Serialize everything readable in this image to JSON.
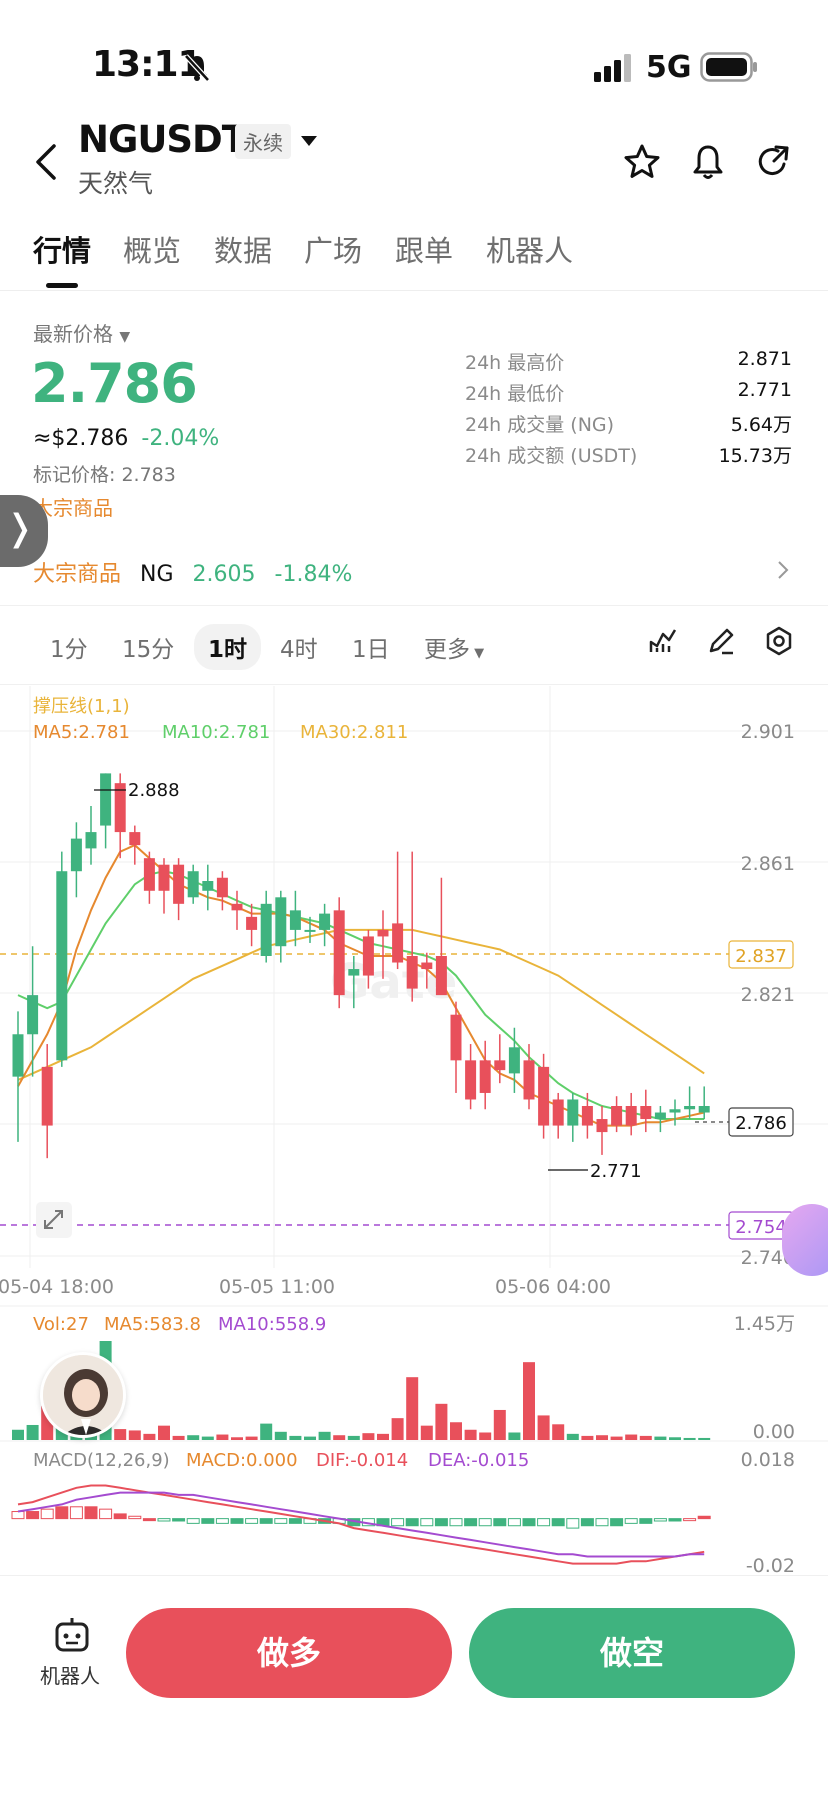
{
  "status_bar": {
    "time": "13:11",
    "network": "5G"
  },
  "header": {
    "pair": "NGUSDT",
    "pair_type": "永续",
    "subtitle": "天然气"
  },
  "tabs": [
    {
      "label": "行情",
      "active": true
    },
    {
      "label": "概览",
      "active": false
    },
    {
      "label": "数据",
      "active": false
    },
    {
      "label": "广场",
      "active": false
    },
    {
      "label": "跟单",
      "active": false
    },
    {
      "label": "机器人",
      "active": false
    }
  ],
  "price": {
    "latest_label": "最新价格",
    "latest": "2.786",
    "usd_value": "≈$2.786",
    "change": "-2.04%",
    "mark_price": "标记价格: 2.783",
    "commodity_tag": "大宗商品"
  },
  "stats": [
    {
      "label": "24h 最高价",
      "value": "2.871"
    },
    {
      "label": "24h 最低价",
      "value": "2.771"
    },
    {
      "label": "24h 成交量 (NG)",
      "value": "5.64万"
    },
    {
      "label": "24h 成交额 (USDT)",
      "value": "15.73万"
    }
  ],
  "commodity_row": {
    "category": "大宗商品",
    "symbol": "NG",
    "price": "2.605",
    "change": "-1.84%"
  },
  "intervals": [
    {
      "label": "1分",
      "active": false
    },
    {
      "label": "15分",
      "active": false
    },
    {
      "label": "1时",
      "active": true
    },
    {
      "label": "4时",
      "active": false
    },
    {
      "label": "1日",
      "active": false
    },
    {
      "label": "更多",
      "active": false
    }
  ],
  "colors": {
    "up": "#3fb37f",
    "down": "#e8505b",
    "accent": "#e6892f",
    "ma5": "#e6892f",
    "ma10": "#5fcf6a",
    "ma30": "#e9b43a"
  },
  "chart_data": {
    "type": "candlestick",
    "indicator": "撑压线(1,1)",
    "ma_legend": {
      "ma5": "MA5:2.781",
      "ma10": "MA10:2.781",
      "ma30": "MA30:2.811"
    },
    "y_ticks": [
      "2.901",
      "2.861",
      "2.821",
      "2.740"
    ],
    "ylim": [
      2.74,
      2.901
    ],
    "x_ticks": [
      "05-04 18:00",
      "05-05 11:00",
      "05-06 04:00"
    ],
    "high_marker": "2.888",
    "low_marker": "2.771",
    "levels": {
      "resistance": "2.837",
      "current": "2.786",
      "support": "2.754"
    },
    "candles": [
      {
        "o": 2.795,
        "h": 2.815,
        "l": 2.775,
        "c": 2.808
      },
      {
        "o": 2.808,
        "h": 2.835,
        "l": 2.795,
        "c": 2.82
      },
      {
        "o": 2.798,
        "h": 2.805,
        "l": 2.77,
        "c": 2.78
      },
      {
        "o": 2.8,
        "h": 2.864,
        "l": 2.798,
        "c": 2.858
      },
      {
        "o": 2.858,
        "h": 2.873,
        "l": 2.85,
        "c": 2.868
      },
      {
        "o": 2.865,
        "h": 2.878,
        "l": 2.86,
        "c": 2.87
      },
      {
        "o": 2.872,
        "h": 2.888,
        "l": 2.865,
        "c": 2.888
      },
      {
        "o": 2.885,
        "h": 2.888,
        "l": 2.862,
        "c": 2.87
      },
      {
        "o": 2.87,
        "h": 2.872,
        "l": 2.86,
        "c": 2.866
      },
      {
        "o": 2.862,
        "h": 2.864,
        "l": 2.848,
        "c": 2.852
      },
      {
        "o": 2.86,
        "h": 2.862,
        "l": 2.845,
        "c": 2.852
      },
      {
        "o": 2.86,
        "h": 2.862,
        "l": 2.843,
        "c": 2.848
      },
      {
        "o": 2.85,
        "h": 2.86,
        "l": 2.848,
        "c": 2.858
      },
      {
        "o": 2.852,
        "h": 2.86,
        "l": 2.846,
        "c": 2.855
      },
      {
        "o": 2.856,
        "h": 2.858,
        "l": 2.846,
        "c": 2.85
      },
      {
        "o": 2.848,
        "h": 2.852,
        "l": 2.84,
        "c": 2.846
      },
      {
        "o": 2.844,
        "h": 2.848,
        "l": 2.835,
        "c": 2.84
      },
      {
        "o": 2.832,
        "h": 2.852,
        "l": 2.83,
        "c": 2.848
      },
      {
        "o": 2.835,
        "h": 2.852,
        "l": 2.83,
        "c": 2.85
      },
      {
        "o": 2.84,
        "h": 2.852,
        "l": 2.835,
        "c": 2.846
      },
      {
        "o": 2.84,
        "h": 2.844,
        "l": 2.836,
        "c": 2.84
      },
      {
        "o": 2.84,
        "h": 2.848,
        "l": 2.835,
        "c": 2.845
      },
      {
        "o": 2.846,
        "h": 2.85,
        "l": 2.816,
        "c": 2.82
      },
      {
        "o": 2.826,
        "h": 2.832,
        "l": 2.816,
        "c": 2.828
      },
      {
        "o": 2.838,
        "h": 2.84,
        "l": 2.822,
        "c": 2.826
      },
      {
        "o": 2.84,
        "h": 2.846,
        "l": 2.825,
        "c": 2.838
      },
      {
        "o": 2.842,
        "h": 2.864,
        "l": 2.828,
        "c": 2.83
      },
      {
        "o": 2.832,
        "h": 2.864,
        "l": 2.818,
        "c": 2.822
      },
      {
        "o": 2.83,
        "h": 2.833,
        "l": 2.822,
        "c": 2.828
      },
      {
        "o": 2.832,
        "h": 2.856,
        "l": 2.822,
        "c": 2.82
      },
      {
        "o": 2.814,
        "h": 2.818,
        "l": 2.79,
        "c": 2.8
      },
      {
        "o": 2.8,
        "h": 2.805,
        "l": 2.785,
        "c": 2.788
      },
      {
        "o": 2.8,
        "h": 2.806,
        "l": 2.785,
        "c": 2.79
      },
      {
        "o": 2.8,
        "h": 2.808,
        "l": 2.793,
        "c": 2.797
      },
      {
        "o": 2.796,
        "h": 2.81,
        "l": 2.79,
        "c": 2.804
      },
      {
        "o": 2.8,
        "h": 2.805,
        "l": 2.785,
        "c": 2.788
      },
      {
        "o": 2.798,
        "h": 2.802,
        "l": 2.776,
        "c": 2.78
      },
      {
        "o": 2.788,
        "h": 2.79,
        "l": 2.776,
        "c": 2.78
      },
      {
        "o": 2.78,
        "h": 2.79,
        "l": 2.775,
        "c": 2.788
      },
      {
        "o": 2.786,
        "h": 2.79,
        "l": 2.776,
        "c": 2.78
      },
      {
        "o": 2.782,
        "h": 2.786,
        "l": 2.771,
        "c": 2.778
      },
      {
        "o": 2.786,
        "h": 2.789,
        "l": 2.778,
        "c": 2.78
      },
      {
        "o": 2.786,
        "h": 2.79,
        "l": 2.777,
        "c": 2.78
      },
      {
        "o": 2.786,
        "h": 2.791,
        "l": 2.778,
        "c": 2.782
      },
      {
        "o": 2.782,
        "h": 2.786,
        "l": 2.778,
        "c": 2.784
      },
      {
        "o": 2.784,
        "h": 2.788,
        "l": 2.78,
        "c": 2.785
      },
      {
        "o": 2.785,
        "h": 2.792,
        "l": 2.782,
        "c": 2.786
      },
      {
        "o": 2.784,
        "h": 2.792,
        "l": 2.782,
        "c": 2.786
      }
    ],
    "ma5": [
      2.792,
      2.8,
      2.808,
      2.818,
      2.834,
      2.846,
      2.856,
      2.864,
      2.866,
      2.862,
      2.858,
      2.854,
      2.852,
      2.85,
      2.849,
      2.847,
      2.845,
      2.845,
      2.845,
      2.844,
      2.842,
      2.84,
      2.836,
      2.834,
      2.832,
      2.832,
      2.832,
      2.83,
      2.828,
      2.824,
      2.816,
      2.808,
      2.8,
      2.796,
      2.794,
      2.79,
      2.788,
      2.786,
      2.784,
      2.782,
      2.78,
      2.78,
      2.78,
      2.781,
      2.781,
      2.782,
      2.783,
      2.784
    ],
    "ma10": [
      2.82,
      2.818,
      2.816,
      2.818,
      2.826,
      2.834,
      2.842,
      2.848,
      2.854,
      2.857,
      2.858,
      2.857,
      2.855,
      2.853,
      2.851,
      2.849,
      2.847,
      2.846,
      2.845,
      2.844,
      2.843,
      2.842,
      2.84,
      2.838,
      2.836,
      2.835,
      2.834,
      2.833,
      2.832,
      2.83,
      2.826,
      2.82,
      2.814,
      2.81,
      2.806,
      2.801,
      2.797,
      2.793,
      2.79,
      2.788,
      2.786,
      2.785,
      2.784,
      2.783,
      2.782,
      2.782,
      2.782,
      2.782
    ],
    "ma30": [
      2.794,
      2.796,
      2.798,
      2.8,
      2.802,
      2.804,
      2.807,
      2.81,
      2.813,
      2.816,
      2.819,
      2.822,
      2.825,
      2.827,
      2.829,
      2.831,
      2.833,
      2.835,
      2.836,
      2.837,
      2.838,
      2.839,
      2.84,
      2.84,
      2.84,
      2.84,
      2.84,
      2.84,
      2.839,
      2.838,
      2.837,
      2.836,
      2.835,
      2.834,
      2.832,
      2.83,
      2.828,
      2.826,
      2.823,
      2.82,
      2.817,
      2.814,
      2.811,
      2.808,
      2.805,
      2.802,
      2.799,
      2.796
    ],
    "volume": {
      "legend": {
        "vol": "Vol:27",
        "ma5": "MA5:583.8",
        "ma10": "MA10:558.9"
      },
      "y_ticks": [
        "1.45万",
        "0.00"
      ],
      "max": 14500,
      "bars": [
        1500,
        2200,
        5000,
        9500,
        2800,
        11000,
        14500,
        1600,
        1400,
        900,
        2100,
        600,
        700,
        500,
        800,
        400,
        500,
        2400,
        1200,
        600,
        500,
        1200,
        700,
        600,
        1000,
        900,
        3200,
        9200,
        2100,
        5300,
        2600,
        1500,
        1100,
        4400,
        1100,
        11400,
        3600,
        2300,
        900,
        600,
        700,
        500,
        800,
        600,
        500,
        400,
        300,
        300
      ]
    },
    "macd": {
      "legend": {
        "title": "MACD(12,26,9)",
        "macd": "MACD:0.000",
        "dif": "DIF:-0.014",
        "dea": "DEA:-0.015"
      },
      "y_ticks": [
        "0.018",
        "-0.02"
      ],
      "dif": [
        0.006,
        0.007,
        0.009,
        0.011,
        0.013,
        0.014,
        0.014,
        0.013,
        0.012,
        0.011,
        0.01,
        0.009,
        0.008,
        0.007,
        0.006,
        0.005,
        0.004,
        0.003,
        0.002,
        0.001,
        0.0,
        -0.001,
        -0.002,
        -0.004,
        -0.005,
        -0.006,
        -0.007,
        -0.008,
        -0.009,
        -0.01,
        -0.011,
        -0.012,
        -0.013,
        -0.014,
        -0.015,
        -0.016,
        -0.017,
        -0.018,
        -0.019,
        -0.019,
        -0.019,
        -0.019,
        -0.018,
        -0.018,
        -0.017,
        -0.016,
        -0.015,
        -0.014
      ],
      "dea": [
        0.003,
        0.004,
        0.005,
        0.006,
        0.008,
        0.009,
        0.01,
        0.011,
        0.011,
        0.011,
        0.011,
        0.01,
        0.01,
        0.009,
        0.008,
        0.007,
        0.006,
        0.005,
        0.004,
        0.003,
        0.002,
        0.001,
        0.0,
        -0.001,
        -0.002,
        -0.003,
        -0.004,
        -0.005,
        -0.006,
        -0.007,
        -0.008,
        -0.009,
        -0.01,
        -0.011,
        -0.012,
        -0.013,
        -0.014,
        -0.015,
        -0.015,
        -0.016,
        -0.016,
        -0.016,
        -0.016,
        -0.016,
        -0.016,
        -0.016,
        -0.015,
        -0.015
      ],
      "hist": [
        0.003,
        0.003,
        0.004,
        0.005,
        0.005,
        0.005,
        0.004,
        0.002,
        0.001,
        0.0,
        -0.001,
        -0.001,
        -0.002,
        -0.002,
        -0.002,
        -0.002,
        -0.002,
        -0.002,
        -0.002,
        -0.002,
        -0.002,
        -0.002,
        -0.002,
        -0.003,
        -0.003,
        -0.003,
        -0.003,
        -0.003,
        -0.003,
        -0.003,
        -0.003,
        -0.003,
        -0.003,
        -0.003,
        -0.003,
        -0.003,
        -0.003,
        -0.003,
        -0.004,
        -0.003,
        -0.003,
        -0.003,
        -0.002,
        -0.002,
        -0.001,
        -0.001,
        0.0,
        0.001
      ]
    }
  },
  "bottom": {
    "robot_label": "机器人",
    "long_label": "做多",
    "short_label": "做空"
  }
}
